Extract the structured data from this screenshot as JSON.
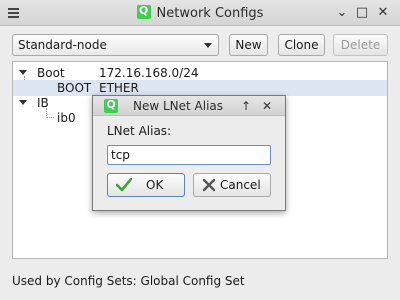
{
  "window": {
    "title": "Network Configs",
    "controls": {
      "collapse": "⌄",
      "maximize": "□",
      "close": "✕"
    }
  },
  "toolbar": {
    "config_select": "Standard-node",
    "new_label": "New",
    "clone_label": "Clone",
    "delete_label": "Delete"
  },
  "tree": {
    "rows": [
      {
        "name": "Boot",
        "value": "172.16.168.0/24"
      },
      {
        "name": "BOOT",
        "value": "ETHER"
      },
      {
        "name": "IB",
        "value": ""
      },
      {
        "name": "ib0",
        "value": ""
      }
    ]
  },
  "status": "Used by Config Sets: Global Config Set",
  "dialog": {
    "title": "New LNet Alias",
    "controls": {
      "up": "↑",
      "close": "✕"
    },
    "label": "LNet Alias:",
    "value": "tcp",
    "ok_label": "OK",
    "cancel_label": "Cancel"
  },
  "colors": {
    "accent": "#41cd52",
    "selection": "#dce6f2",
    "focus": "#6a8fc2"
  }
}
